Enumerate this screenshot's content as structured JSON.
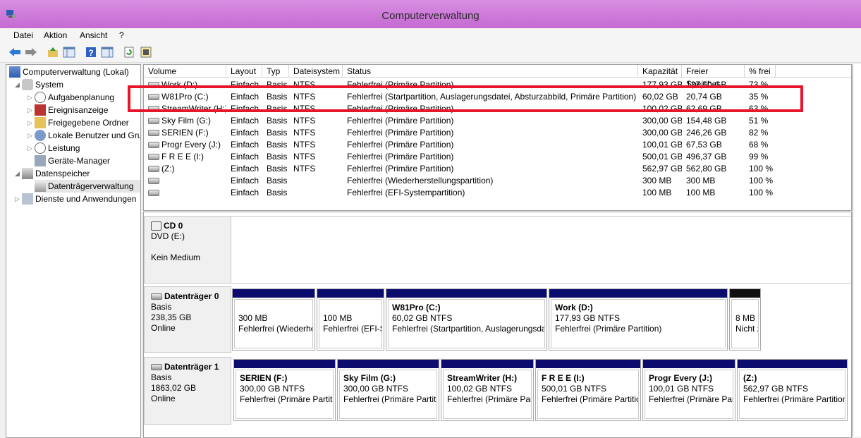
{
  "window": {
    "title": "Computerverwaltung"
  },
  "menu": [
    "Datei",
    "Aktion",
    "Ansicht",
    "?"
  ],
  "toolbar": [
    "back-icon",
    "forward-icon",
    "up-icon",
    "show-hide-tree-icon",
    "help-icon",
    "properties-icon",
    "refresh-icon",
    "export-icon"
  ],
  "tree": {
    "root": "Computerverwaltung (Lokal)",
    "system": "System",
    "aufgaben": "Aufgabenplanung",
    "ereignis": "Ereignisanzeige",
    "freigaben": "Freigegebene Ordner",
    "benutzer": "Lokale Benutzer und Gruppen",
    "leistung": "Leistung",
    "geraete": "Geräte-Manager",
    "datenspeicher": "Datenspeicher",
    "dtv": "Datenträgerverwaltung",
    "dienste": "Dienste und Anwendungen"
  },
  "volume_table": {
    "headers": [
      "Volume",
      "Layout",
      "Typ",
      "Dateisystem",
      "Status",
      "Kapazität",
      "Freier Speicher",
      "% frei"
    ],
    "rows": [
      [
        "Work (D:)",
        "Einfach",
        "Basis",
        "NTFS",
        "Fehlerfrei (Primäre Partition)",
        "177,93 GB",
        "137,50 GB",
        "73 %"
      ],
      [
        "W81Pro (C:)",
        "Einfach",
        "Basis",
        "NTFS",
        "Fehlerfrei (Startpartition, Auslagerungsdatei, Absturzabbild, Primäre Partition)",
        "60,02 GB",
        "20,74 GB",
        "35 %"
      ],
      [
        "StreamWriter (H:)",
        "Einfach",
        "Basis",
        "NTFS",
        "Fehlerfrei (Primäre Partition)",
        "100,02 GB",
        "62,69 GB",
        "63 %"
      ],
      [
        "Sky Film (G:)",
        "Einfach",
        "Basis",
        "NTFS",
        "Fehlerfrei (Primäre Partition)",
        "300,00 GB",
        "154,48 GB",
        "51 %"
      ],
      [
        "SERIEN (F:)",
        "Einfach",
        "Basis",
        "NTFS",
        "Fehlerfrei (Primäre Partition)",
        "300,00 GB",
        "246,26 GB",
        "82 %"
      ],
      [
        "Progr Every (J:)",
        "Einfach",
        "Basis",
        "NTFS",
        "Fehlerfrei (Primäre Partition)",
        "100,01 GB",
        "67,53 GB",
        "68 %"
      ],
      [
        "F R E E (I:)",
        "Einfach",
        "Basis",
        "NTFS",
        "Fehlerfrei (Primäre Partition)",
        "500,01 GB",
        "496,37 GB",
        "99 %"
      ],
      [
        "(Z:)",
        "Einfach",
        "Basis",
        "NTFS",
        "Fehlerfrei (Primäre Partition)",
        "562,97 GB",
        "562,80 GB",
        "100 %"
      ],
      [
        "",
        "Einfach",
        "Basis",
        "",
        "Fehlerfrei (Wiederherstellungspartition)",
        "300 MB",
        "300 MB",
        "100 %"
      ],
      [
        "",
        "Einfach",
        "Basis",
        "",
        "Fehlerfrei (EFI-Systempartition)",
        "100 MB",
        "100 MB",
        "100 %"
      ]
    ]
  },
  "cd": {
    "name": "CD 0",
    "type": "DVD (E:)",
    "status": "Kein Medium"
  },
  "disk0": {
    "name": "Datenträger 0",
    "type": "Basis",
    "size": "238,35 GB",
    "state": "Online",
    "parts": [
      {
        "name": "",
        "size": "300 MB",
        "status": "Fehlerfrei (Wiederherstellungspartition)"
      },
      {
        "name": "",
        "size": "100 MB",
        "status": "Fehlerfrei (EFI-Systempartition)"
      },
      {
        "name": "W81Pro  (C:)",
        "size": "60,02 GB NTFS",
        "status": "Fehlerfrei (Startpartition, Auslagerungsdatei, Absturzabbild)"
      },
      {
        "name": "Work  (D:)",
        "size": "177,93 GB NTFS",
        "status": "Fehlerfrei (Primäre Partition)"
      },
      {
        "name": "",
        "size": "8 MB",
        "status": "Nicht zugeordnet"
      }
    ]
  },
  "disk1": {
    "name": "Datenträger 1",
    "type": "Basis",
    "size": "1863,02 GB",
    "state": "Online",
    "parts": [
      {
        "name": "SERIEN  (F:)",
        "size": "300,00 GB NTFS",
        "status": "Fehlerfrei (Primäre Partition)"
      },
      {
        "name": "Sky Film  (G:)",
        "size": "300,00 GB NTFS",
        "status": "Fehlerfrei (Primäre Partition)"
      },
      {
        "name": "StreamWriter  (H:)",
        "size": "100,02 GB NTFS",
        "status": "Fehlerfrei (Primäre Partition)"
      },
      {
        "name": "F R E E  (I:)",
        "size": "500,01 GB NTFS",
        "status": "Fehlerfrei (Primäre Partition)"
      },
      {
        "name": "Progr Every  (J:)",
        "size": "100,01 GB NTFS",
        "status": "Fehlerfrei (Primäre Partition)"
      },
      {
        "name": "(Z:)",
        "size": "562,97 GB NTFS",
        "status": "Fehlerfrei (Primäre Partition)"
      }
    ]
  },
  "colors": {
    "highlight": "#e8162c",
    "partition_bar": "#0c0c6e",
    "unallocated_bar": "#111111",
    "titlebar": "#c96fd6"
  }
}
